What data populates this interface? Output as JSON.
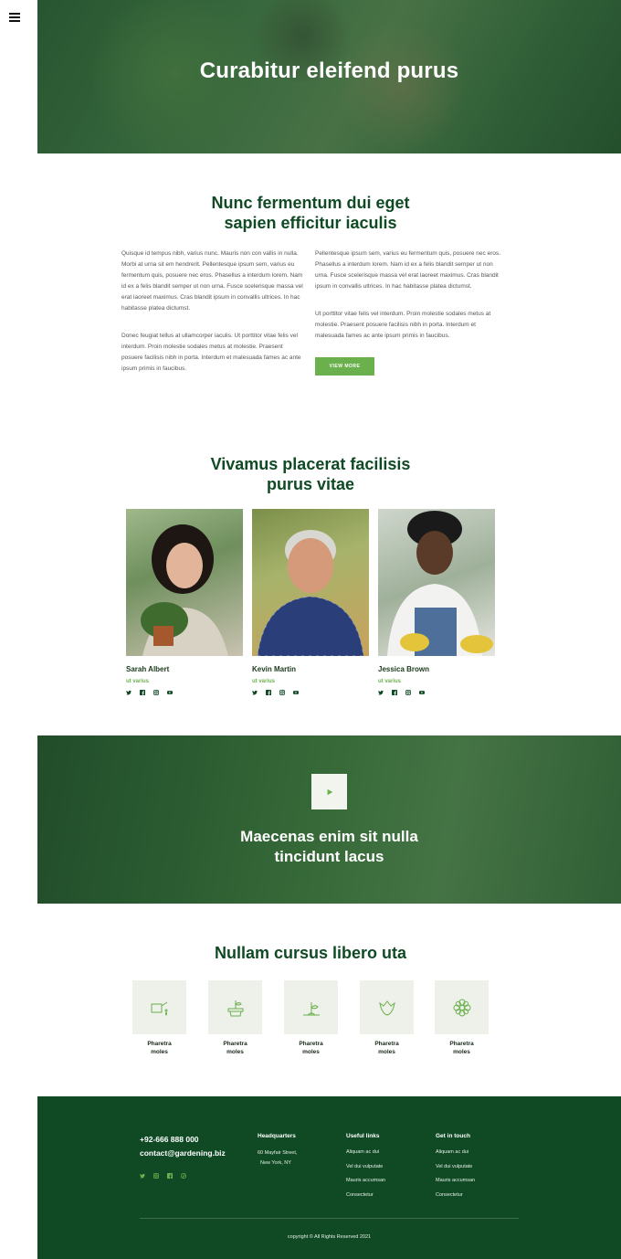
{
  "hero": {
    "title": "Curabitur eleifend purus"
  },
  "about": {
    "title_line1": "Nunc fermentum dui eget",
    "title_line2": "sapien efficitur iaculis",
    "col1_p1": "Quisque id tempus nibh, varius nunc. Mauris non con vallis in nulla. Morbi at urna sit em hendrerit. Pellentesque ipsum sem, varius eu fermentum quis, posuere nec eros. Phasellus a interdum lorem. Nam id ex a felis blandit semper ut non urna. Fusce scelerisque massa vel erat laoreet maximus. Cras blandit ipsum in convallis ultrices. In hac habitasse platea dictumst.",
    "col1_p2": "Donec feugiat tellus at ullamcorper iaculis. Ut porttitor vitae felis vel interdum. Proin molestie sodales metus at molestie. Praesent posuere facilisis nibh in porta. Interdum et malesuada fames ac ante ipsum primis in faucibus.",
    "col2_p1": "Pellentesque ipsum sem, varius eu fermentum quis, posuere nec eros. Phasellus a interdum lorem. Nam id ex a felis blandit semper ut non urna. Fusce scelerisque massa vel erat laoreet maximus. Cras blandit ipsum in convallis ultrices. In hac habitasse platea dictumst.",
    "col2_p2": "Ut porttitor vitae felis vel interdum. Proin molestie sodales metus at molestie. Praesent posuere facilisis nibh in porta. Interdum et malesuada fames ac ante ipsum primis in faucibus.",
    "button": "VIEW MORE"
  },
  "team": {
    "title_line1": "Vivamus placerat facilisis",
    "title_line2": "purus vitae",
    "members": [
      {
        "name": "Sarah Albert",
        "role": "ut varius"
      },
      {
        "name": "Kevin Martin",
        "role": "ut varius"
      },
      {
        "name": "Jessica Brown",
        "role": "ut varius"
      }
    ],
    "social_icons": [
      "twitter-icon",
      "facebook-icon",
      "instagram-icon",
      "youtube-icon"
    ]
  },
  "video": {
    "title_line1": "Maecenas enim sit nulla",
    "title_line2": "tincidunt lacus",
    "icon": "play-icon"
  },
  "services": {
    "title": "Nullam cursus libero uta",
    "items": [
      {
        "label_line1": "Pharetra",
        "label_line2": "moles",
        "icon": "watering-can-icon"
      },
      {
        "label_line1": "Pharetra",
        "label_line2": "moles",
        "icon": "potted-plant-icon"
      },
      {
        "label_line1": "Pharetra",
        "label_line2": "moles",
        "icon": "sprout-icon"
      },
      {
        "label_line1": "Pharetra",
        "label_line2": "moles",
        "icon": "tulip-icon"
      },
      {
        "label_line1": "Pharetra",
        "label_line2": "moles",
        "icon": "flower-icon"
      }
    ]
  },
  "footer": {
    "phone": "+92-666 888 000",
    "email": "contact@gardening.biz",
    "hq_title": "Headquarters",
    "hq_line1": "60  Mayfair Street,",
    "hq_line2": "New York, NY",
    "links_title": "Useful links",
    "links": [
      "Aliquam ac dui",
      "Vel dui vulputate",
      "Mauris accumsan",
      "Consectetur"
    ],
    "touch_title": "Get in touch",
    "touch": [
      "Aliquam ac dui",
      "Vel dui vulputate",
      "Mauris accumsan",
      "Consectetur"
    ],
    "social_icons": [
      "twitter-icon",
      "instagram-icon",
      "facebook-icon",
      "pinterest-icon"
    ],
    "copyright": "copyright © All Rights Reserved 2021"
  },
  "colors": {
    "brand_dark": "#0f4a24",
    "accent": "#6ab04c",
    "tile": "#eef1ea"
  }
}
